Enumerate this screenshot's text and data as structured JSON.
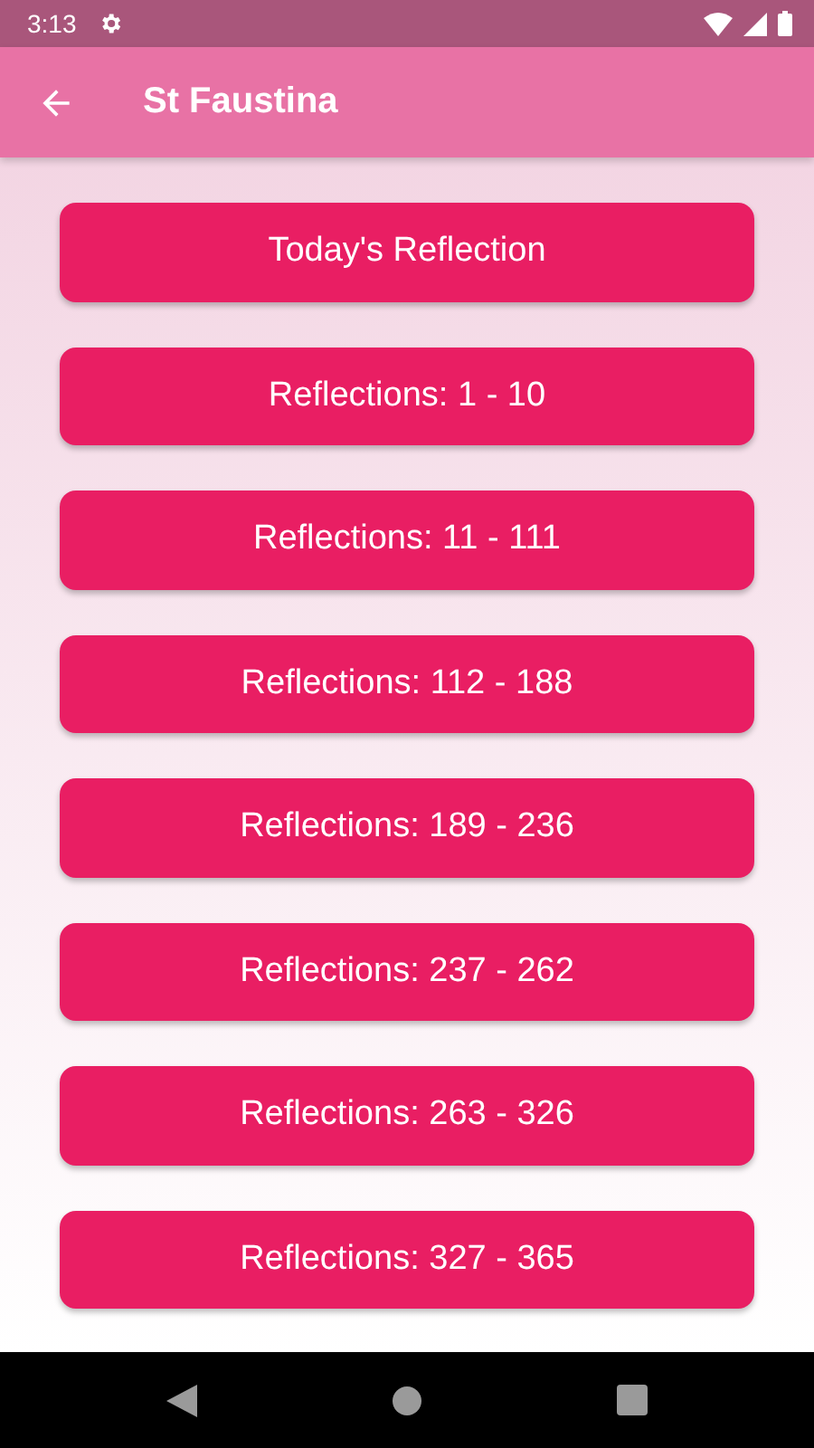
{
  "status_bar": {
    "time": "3:13"
  },
  "app_bar": {
    "title": "St Faustina"
  },
  "buttons": [
    {
      "label": "Today's Reflection"
    },
    {
      "label": "Reflections: 1 - 10"
    },
    {
      "label": "Reflections: 11 - 111"
    },
    {
      "label": "Reflections: 112 - 188"
    },
    {
      "label": "Reflections: 189 - 236"
    },
    {
      "label": "Reflections: 237 - 262"
    },
    {
      "label": "Reflections: 263 - 326"
    },
    {
      "label": "Reflections: 327 - 365"
    }
  ]
}
